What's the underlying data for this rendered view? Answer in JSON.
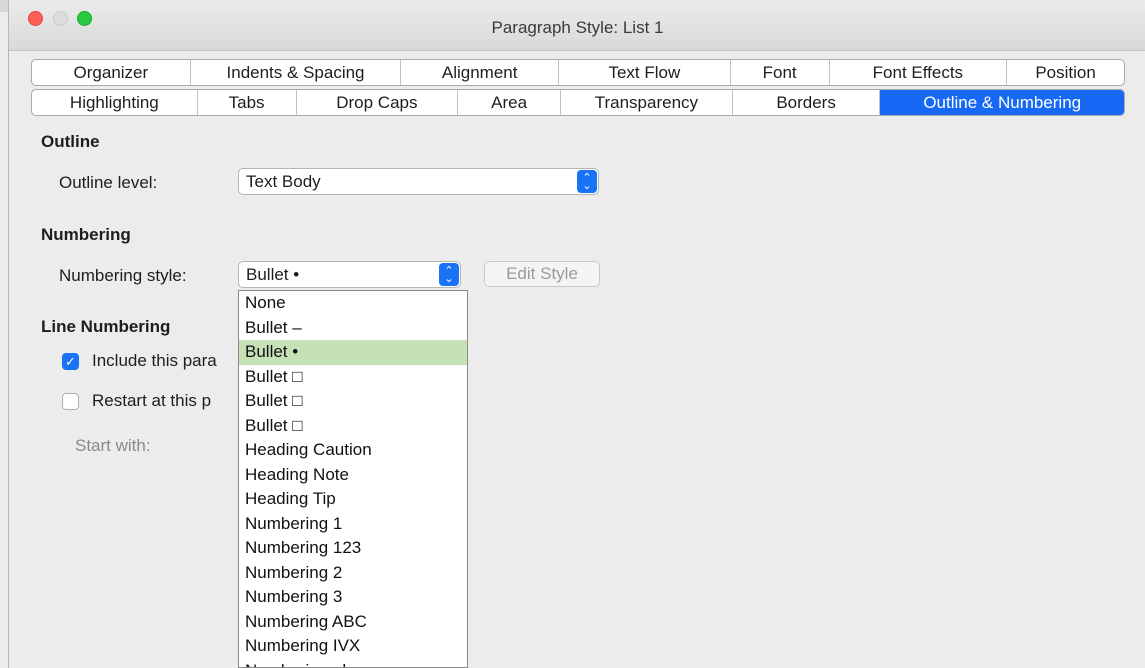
{
  "window": {
    "title": "Paragraph Style: List 1"
  },
  "tabs_row1": [
    "Organizer",
    "Indents & Spacing",
    "Alignment",
    "Text Flow",
    "Font",
    "Font Effects",
    "Position"
  ],
  "tabs_row2": [
    "Highlighting",
    "Tabs",
    "Drop Caps",
    "Area",
    "Transparency",
    "Borders",
    "Outline & Numbering"
  ],
  "active_tab": "Outline & Numbering",
  "outline": {
    "section_title": "Outline",
    "level_label": "Outline level:",
    "level_value": "Text Body"
  },
  "numbering": {
    "section_title": "Numbering",
    "style_label": "Numbering style:",
    "style_value": "Bullet •",
    "edit_style_label": "Edit Style"
  },
  "line_numbering": {
    "section_title": "Line Numbering",
    "include_label": "Include this para",
    "include_checked": true,
    "restart_label": "Restart at this p",
    "restart_checked": false,
    "start_with_label": "Start with:"
  },
  "dropdown": {
    "items": [
      "None",
      "Bullet –",
      "Bullet •",
      "Bullet □",
      "Bullet □",
      "Bullet □",
      "Heading Caution",
      "Heading Note",
      "Heading Tip",
      "Numbering 1",
      "Numbering 123",
      "Numbering 2",
      "Numbering 3",
      "Numbering ABC",
      "Numbering IVX",
      "Numbering abc"
    ],
    "selected_index": 2
  },
  "colors": {
    "accent": "#1769f5",
    "selection": "#c7e1b6"
  }
}
